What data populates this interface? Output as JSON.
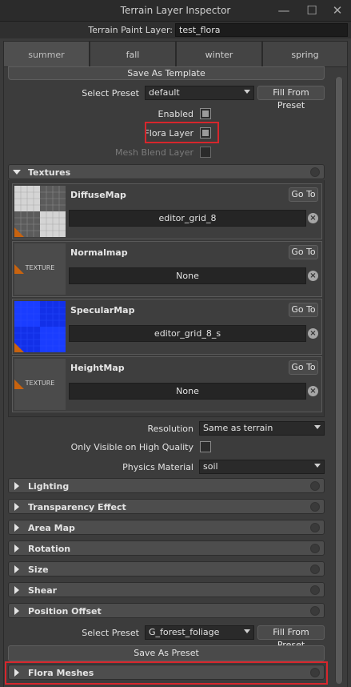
{
  "window": {
    "title": "Terrain Layer Inspector",
    "minimize_icon": "minimize-icon",
    "maximize_icon": "maximize-icon",
    "close_icon": "close-icon"
  },
  "paint_layer": {
    "label": "Terrain Paint Layer:",
    "value": "test_flora"
  },
  "tabs": [
    {
      "label": "summer",
      "active": true
    },
    {
      "label": "fall",
      "active": false
    },
    {
      "label": "winter",
      "active": false
    },
    {
      "label": "spring",
      "active": false
    }
  ],
  "top": {
    "save_as_template": "Save As Template",
    "select_preset_label": "Select Preset",
    "select_preset_value": "default",
    "fill_from_preset": "Fill From Preset",
    "enabled_label": "Enabled",
    "enabled_checked": true,
    "flora_layer_label": "Flora Layer",
    "flora_layer_checked": true,
    "mesh_blend_label": "Mesh Blend Layer",
    "mesh_blend_checked": false
  },
  "textures": {
    "title": "Textures",
    "goto_label": "Go To",
    "items": [
      {
        "name": "DiffuseMap",
        "value": "editor_grid_8",
        "thumb": "checker-gray"
      },
      {
        "name": "Normalmap",
        "value": "None",
        "thumb": "generic",
        "thumb_text": "TEXTURE"
      },
      {
        "name": "SpecularMap",
        "value": "editor_grid_8_s",
        "thumb": "checker-blue"
      },
      {
        "name": "HeightMap",
        "value": "None",
        "thumb": "generic",
        "thumb_text": "TEXTURE"
      }
    ]
  },
  "settings": {
    "resolution_label": "Resolution",
    "resolution_value": "Same as terrain",
    "high_quality_label": "Only Visible on High Quality",
    "high_quality_checked": false,
    "physics_label": "Physics Material",
    "physics_value": "soil"
  },
  "sections": [
    "Lighting",
    "Transparency Effect",
    "Area Map",
    "Rotation",
    "Size",
    "Shear",
    "Position Offset"
  ],
  "bottom": {
    "select_preset_label": "Select Preset",
    "select_preset_value": "G_forest_foliage",
    "fill_from_preset": "Fill From Preset",
    "save_as_preset": "Save As Preset",
    "flora_meshes": "Flora Meshes"
  },
  "colors": {
    "highlight": "#d7262c",
    "thumb_corner": "#c8630f",
    "specular_blue": "#1a3dff"
  }
}
